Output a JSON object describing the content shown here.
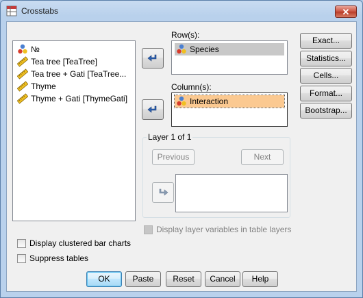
{
  "window": {
    "title": "Crosstabs",
    "close_label": "✕"
  },
  "source_list": {
    "items": [
      {
        "label": "№",
        "icon": "nominal-variable-icon"
      },
      {
        "label": "Tea tree [TeaTree]",
        "icon": "scale-variable-icon"
      },
      {
        "label": "Tea tree + Gati [TeaTree...",
        "icon": "scale-variable-icon"
      },
      {
        "label": "Thyme",
        "icon": "scale-variable-icon"
      },
      {
        "label": "Thyme + Gati [ThymeGati]",
        "icon": "scale-variable-icon"
      }
    ]
  },
  "rows": {
    "label": "Row(s):",
    "items": [
      {
        "label": "Species",
        "icon": "nominal-variable-icon"
      }
    ]
  },
  "columns": {
    "label": "Column(s):",
    "items": [
      {
        "label": "Interaction",
        "icon": "nominal-variable-icon"
      }
    ]
  },
  "layer": {
    "legend": "Layer 1 of 1",
    "previous": "Previous",
    "next": "Next"
  },
  "side_buttons": {
    "exact": "Exact...",
    "statistics": "Statistics...",
    "cells": "Cells...",
    "format": "Format...",
    "bootstrap": "Bootstrap..."
  },
  "options": {
    "display_layer_vars": "Display layer variables in table layers",
    "clustered_bars": "Display clustered bar charts",
    "suppress_tables": "Suppress tables"
  },
  "footer": {
    "ok": "OK",
    "paste": "Paste",
    "reset": "Reset",
    "cancel": "Cancel",
    "help": "Help"
  },
  "colors": {
    "row_selection": "#c8c8c8",
    "column_selection": "#fbc991",
    "default_button": "#3c7fb1"
  }
}
